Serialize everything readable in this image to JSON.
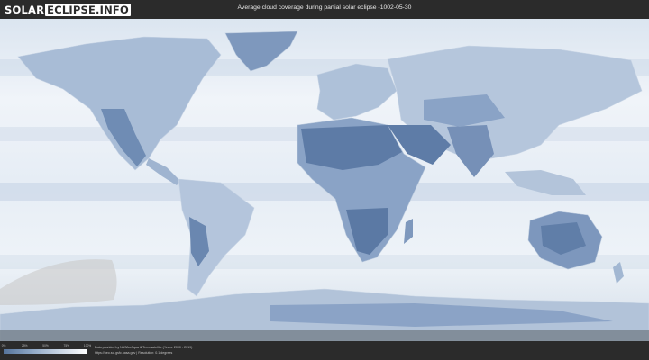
{
  "header": {
    "logo_part1": "SOLAR",
    "logo_part2": "ECLIPSE.INFO",
    "title": "Average cloud coverage during partial solar eclipse -1002-05-30"
  },
  "legend": {
    "ticks": [
      "0%",
      "25%",
      "50%",
      "75%",
      "100%"
    ],
    "colors": [
      "#56749c",
      "#8da6c4",
      "#c8d5e4",
      "#ffffff"
    ]
  },
  "credits": {
    "line1": "Data provided by NASAs Aqua & Terra satellite (Years: 2000 - 2019)",
    "line2": "https://neo.sci.gsfc.nasa.gov | Resolution: 0.1 degrees"
  },
  "map": {
    "ocean_color": "#eaf0f7",
    "land_clear_color": "#6e8bb2",
    "ice_color": "#f4f7fb"
  }
}
